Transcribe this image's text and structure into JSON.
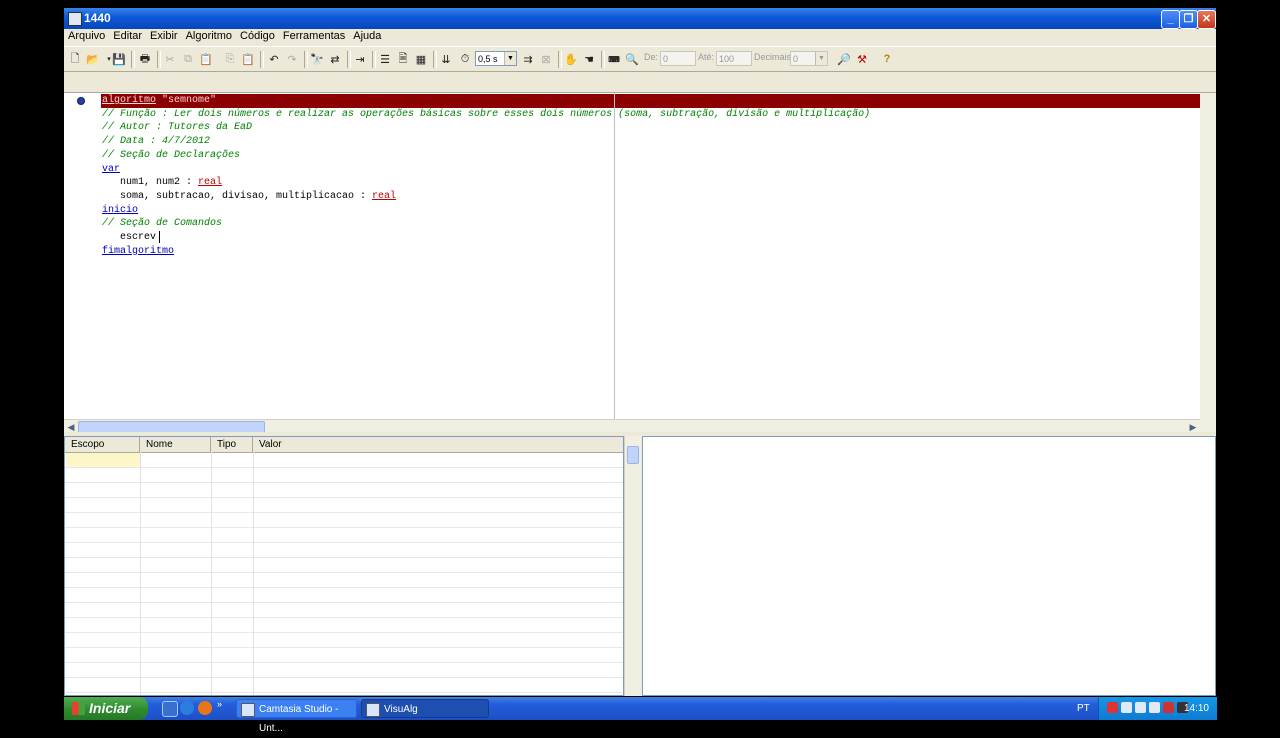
{
  "window": {
    "title": "1440"
  },
  "menu": [
    "Arquivo",
    "Editar",
    "Exibir",
    "Algoritmo",
    "Código",
    "Ferramentas",
    "Ajuda"
  ],
  "toolbar": {
    "speed": "0,5 s",
    "de_label": "De:",
    "de_value": "0",
    "ate_label": "Até:",
    "ate_value": "100",
    "decimais_label": "Decimais:",
    "decimais_value": "0",
    "help_glyph": "?"
  },
  "editor": {
    "lines": [
      [
        {
          "t": "algoritmo",
          "c": "kw-red"
        },
        {
          "t": " \"semnome\"",
          "c": "onred"
        }
      ],
      [
        {
          "t": "// Função : Ler dois números e realizar as operações básicas sobre esses dois números (soma, subtração, divisão e multiplicação)",
          "c": "cmt"
        }
      ],
      [
        {
          "t": "// Autor : Tutores da EaD",
          "c": "cmt"
        }
      ],
      [
        {
          "t": "// Data : 4/7/2012",
          "c": "cmt"
        }
      ],
      [
        {
          "t": "// Seção de Declarações",
          "c": "cmt"
        }
      ],
      [
        {
          "t": "var",
          "c": "kw"
        }
      ],
      [
        {
          "t": "   num1, num2 : ",
          "c": "plain"
        },
        {
          "t": "real",
          "c": "ty"
        }
      ],
      [
        {
          "t": "   soma, subtracao, divisao, multiplicacao : ",
          "c": "plain"
        },
        {
          "t": "real",
          "c": "ty"
        }
      ],
      [
        {
          "t": "inicio",
          "c": "kw"
        }
      ],
      [
        {
          "t": "// Seção de Comandos",
          "c": "cmt"
        }
      ],
      [
        {
          "t": "   escrev",
          "c": "plain"
        }
      ],
      [
        {
          "t": "fimalgoritmo",
          "c": "kw"
        }
      ]
    ]
  },
  "variables": {
    "columns": [
      "Escopo",
      "Nome",
      "Tipo",
      "Valor"
    ]
  },
  "taskbar": {
    "start_label": "Iniciar",
    "tasks": [
      "Camtasia Studio - Unt...",
      "VisuAlg"
    ],
    "language": "PT",
    "clock": "14:10"
  }
}
